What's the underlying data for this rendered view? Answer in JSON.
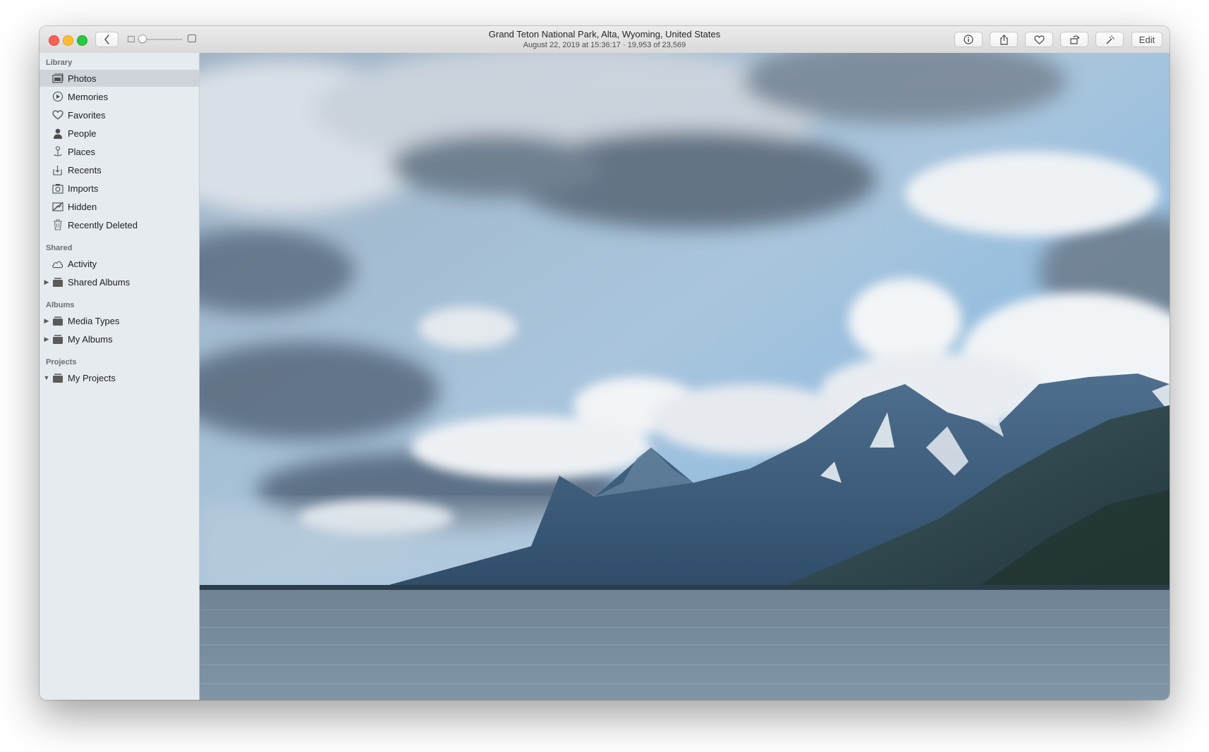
{
  "window": {
    "title": "Grand Teton National Park, Alta, Wyoming, United States",
    "subtitle": "August 22, 2019 at 15:36:17  ·  19,953 of 23,569"
  },
  "toolbar": {
    "back_icon": "chevron-left-icon",
    "zoom_slider_value": 0.05,
    "info_icon": "info-icon",
    "share_icon": "share-icon",
    "favorite_icon": "heart-icon",
    "rotate_icon": "rotate-icon",
    "enhance_icon": "magic-wand-icon",
    "edit_label": "Edit"
  },
  "sidebar": {
    "library_header": "Library",
    "library_items": [
      {
        "label": "Photos",
        "icon": "photos-icon",
        "selected": true
      },
      {
        "label": "Memories",
        "icon": "memories-icon"
      },
      {
        "label": "Favorites",
        "icon": "heart-icon"
      },
      {
        "label": "People",
        "icon": "person-icon"
      },
      {
        "label": "Places",
        "icon": "pin-icon"
      },
      {
        "label": "Recents",
        "icon": "recents-icon"
      },
      {
        "label": "Imports",
        "icon": "camera-icon"
      },
      {
        "label": "Hidden",
        "icon": "hidden-icon"
      },
      {
        "label": "Recently Deleted",
        "icon": "trash-icon"
      }
    ],
    "shared_header": "Shared",
    "shared_items": [
      {
        "label": "Activity",
        "icon": "cloud-icon"
      },
      {
        "label": "Shared Albums",
        "icon": "folder-icon",
        "disclosure": "collapsed"
      }
    ],
    "albums_header": "Albums",
    "albums_items": [
      {
        "label": "Media Types",
        "icon": "folder-icon",
        "disclosure": "collapsed"
      },
      {
        "label": "My Albums",
        "icon": "folder-icon",
        "disclosure": "collapsed"
      }
    ],
    "projects_header": "Projects",
    "projects_items": [
      {
        "label": "My Projects",
        "icon": "folder-icon",
        "disclosure": "expanded"
      }
    ]
  },
  "colors": {
    "close": "#fe5f57",
    "minimize": "#febc2e",
    "maximize": "#28c840",
    "sidebar_bg": "#e6ebf0",
    "selection": "#cfd4da"
  }
}
